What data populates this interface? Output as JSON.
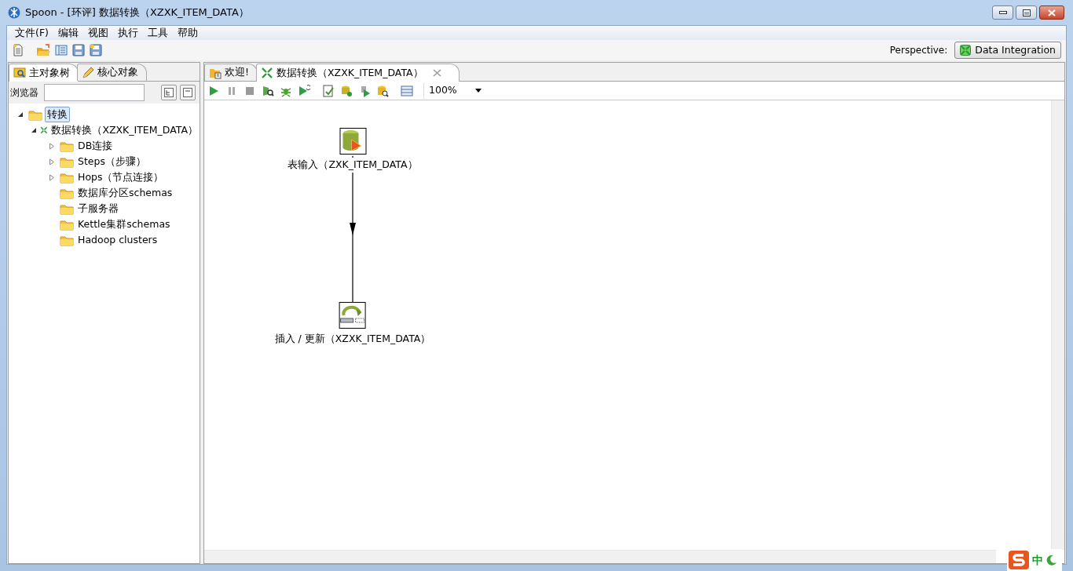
{
  "window": {
    "title": "Spoon - [环评] 数据转换（XZXK_ITEM_DATA）"
  },
  "menu": [
    "文件(F)",
    "编辑",
    "视图",
    "执行",
    "工具",
    "帮助"
  ],
  "perspective": {
    "label": "Perspective:",
    "button": "Data Integration"
  },
  "left_tabs": [
    {
      "label": "主对象树",
      "selected": true,
      "kind": "tree"
    },
    {
      "label": "核心对象",
      "selected": false,
      "kind": "pencil"
    }
  ],
  "browser": {
    "label": "浏览器"
  },
  "tree": [
    {
      "label": "转换",
      "kind": "folder",
      "selected": true,
      "expanded": true,
      "children": [
        {
          "label": "数据转换（XZXK_ITEM_DATA）",
          "kind": "transform",
          "selected": false,
          "expanded": true,
          "children": [
            {
              "label": "DB连接",
              "kind": "folder",
              "selected": false,
              "expanded": false
            },
            {
              "label": "Steps（步骤）",
              "kind": "folder",
              "selected": false,
              "expanded": false
            },
            {
              "label": "Hops（节点连接）",
              "kind": "folder",
              "selected": false,
              "expanded": false
            },
            {
              "label": "数据库分区schemas",
              "kind": "folder",
              "selected": false
            },
            {
              "label": "子服务器",
              "kind": "folder",
              "selected": false
            },
            {
              "label": "Kettle集群schemas",
              "kind": "folder",
              "selected": false
            },
            {
              "label": "Hadoop clusters",
              "kind": "folder",
              "selected": false
            }
          ]
        }
      ]
    }
  ],
  "editor_tabs": [
    {
      "label": "欢迎!",
      "kind": "welcome",
      "selected": false
    },
    {
      "label": "数据转换（XZXK_ITEM_DATA）",
      "kind": "transform",
      "selected": true
    }
  ],
  "zoom": "100%",
  "steps": [
    {
      "label": "表输入（ZXK_ITEM_DATA）",
      "kind": "table-input"
    },
    {
      "label": "插入 / 更新（XZXK_ITEM_DATA）",
      "kind": "insert-update"
    }
  ],
  "ime": {
    "mode": "中"
  }
}
